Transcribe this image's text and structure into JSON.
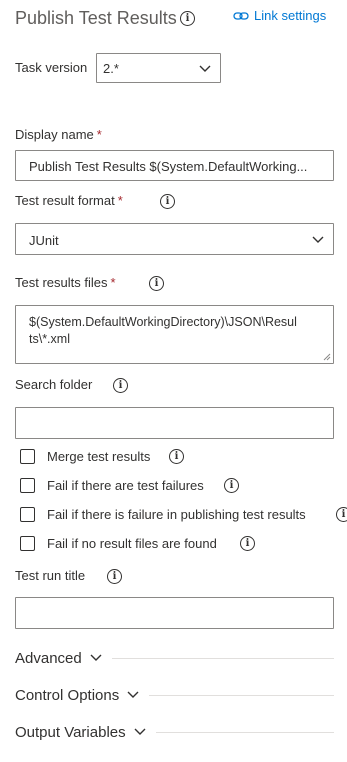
{
  "header": {
    "title": "Publish Test Results",
    "link_settings": "Link settings"
  },
  "task_version": {
    "label": "Task version",
    "value": "2.*"
  },
  "display_name": {
    "label": "Display name",
    "required": "*",
    "value": "Publish Test Results $(System.DefaultWorking..."
  },
  "test_result_format": {
    "label": "Test result format",
    "required": "*",
    "value": "JUnit"
  },
  "test_results_files": {
    "label": "Test results files",
    "required": "*",
    "value_line1": "$(System.DefaultWorkingDirectory)\\JSON\\Resul",
    "value_line2": "ts\\*.xml"
  },
  "search_folder": {
    "label": "Search folder",
    "value": ""
  },
  "checkboxes": [
    {
      "label": "Merge test results",
      "checked": false
    },
    {
      "label": "Fail if there are test failures",
      "checked": false
    },
    {
      "label": "Fail if there is failure in publishing test results",
      "checked": false
    },
    {
      "label": "Fail if no result files are found",
      "checked": false
    }
  ],
  "test_run_title": {
    "label": "Test run title",
    "value": ""
  },
  "sections": [
    {
      "label": "Advanced"
    },
    {
      "label": "Control Options"
    },
    {
      "label": "Output Variables"
    }
  ],
  "colors": {
    "link": "#0078d4",
    "required": "#a4262c",
    "border": "#8a8886",
    "text": "#323130"
  }
}
